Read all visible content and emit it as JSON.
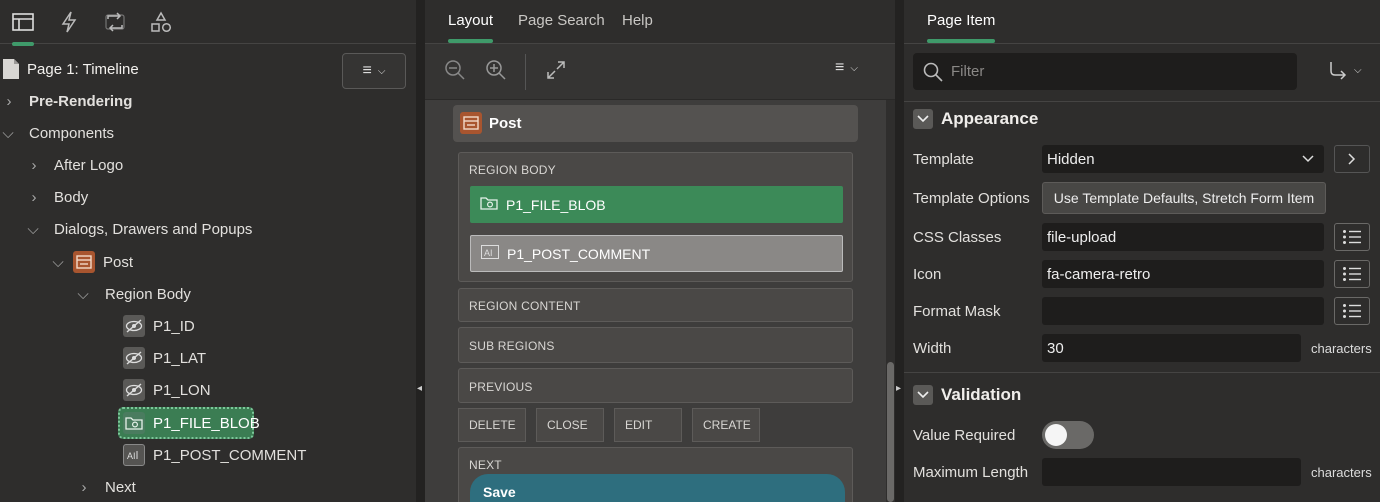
{
  "left": {
    "tabs": [
      "rendering-icon",
      "dynamic-actions-icon",
      "processing-icon",
      "shared-components-icon"
    ],
    "page_title": "Page 1: Timeline",
    "tree": {
      "pre_rendering": "Pre-Rendering",
      "components": "Components",
      "after_logo": "After Logo",
      "body": "Body",
      "dialogs": "Dialogs, Drawers and Popups",
      "post": "Post",
      "region_body": "Region Body",
      "items": [
        "P1_ID",
        "P1_LAT",
        "P1_LON",
        "P1_FILE_BLOB",
        "P1_POST_COMMENT"
      ],
      "next": "Next"
    }
  },
  "middle": {
    "tabs": {
      "layout": "Layout",
      "page_search": "Page Search",
      "help": "Help"
    },
    "region_title": "Post",
    "region_body_label": "REGION BODY",
    "item_file": "P1_FILE_BLOB",
    "item_comment": "P1_POST_COMMENT",
    "region_content": "REGION CONTENT",
    "sub_regions": "SUB REGIONS",
    "previous": "PREVIOUS",
    "buttons": [
      "DELETE",
      "CLOSE",
      "EDIT",
      "CREATE"
    ],
    "next": "NEXT",
    "save": "Save"
  },
  "right": {
    "tab": "Page Item",
    "filter_placeholder": "Filter",
    "appearance": "Appearance",
    "template_label": "Template",
    "template_value": "Hidden",
    "template_options_label": "Template Options",
    "template_options_value": "Use Template Defaults, Stretch Form Item",
    "css_classes_label": "CSS Classes",
    "css_classes_value": "file-upload",
    "icon_label": "Icon",
    "icon_value": "fa-camera-retro",
    "format_mask_label": "Format Mask",
    "format_mask_value": "",
    "width_label": "Width",
    "width_value": "30",
    "characters": "characters",
    "validation": "Validation",
    "value_required_label": "Value Required",
    "value_required": false,
    "max_length_label": "Maximum Length",
    "max_length_value": ""
  },
  "colors": {
    "accent": "#3f9a6a",
    "save": "#2e6e7e",
    "post_icon": "#a8552f"
  }
}
